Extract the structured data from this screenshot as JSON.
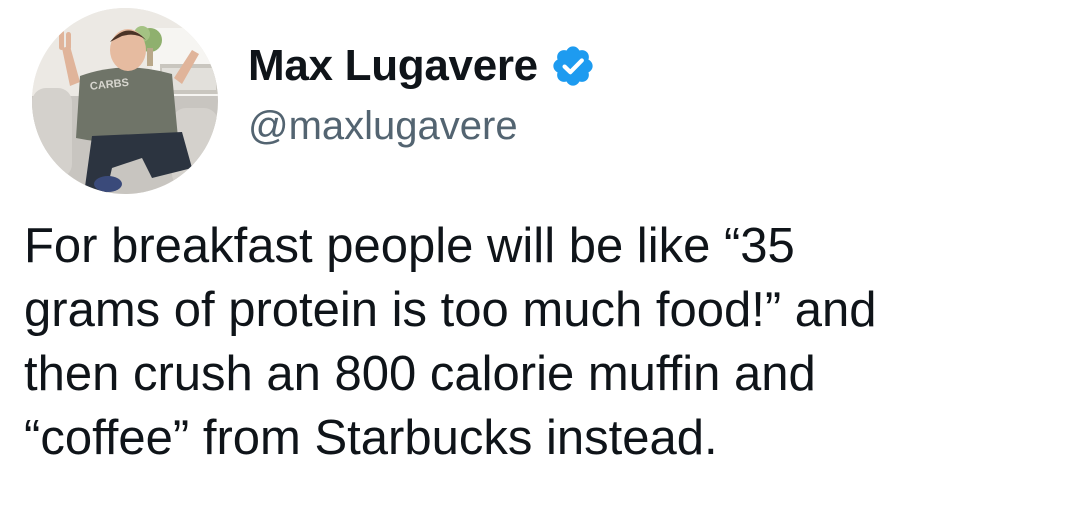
{
  "author": {
    "display_name": "Max Lugavere",
    "handle": "@maxlugavere",
    "verified": true,
    "avatar_shirt_text": "CARBS"
  },
  "tweet": {
    "lines": [
      "For breakfast people will be like “35",
      "grams of protein is too much food!” and",
      "then crush an 800 calorie muffin and",
      "“coffee” from Starbucks instead."
    ]
  },
  "colors": {
    "verified_badge": "#1d9bf0",
    "handle_text": "#536471",
    "body_text": "#0f1419"
  },
  "icons": {
    "verified": "verified-badge-icon"
  }
}
